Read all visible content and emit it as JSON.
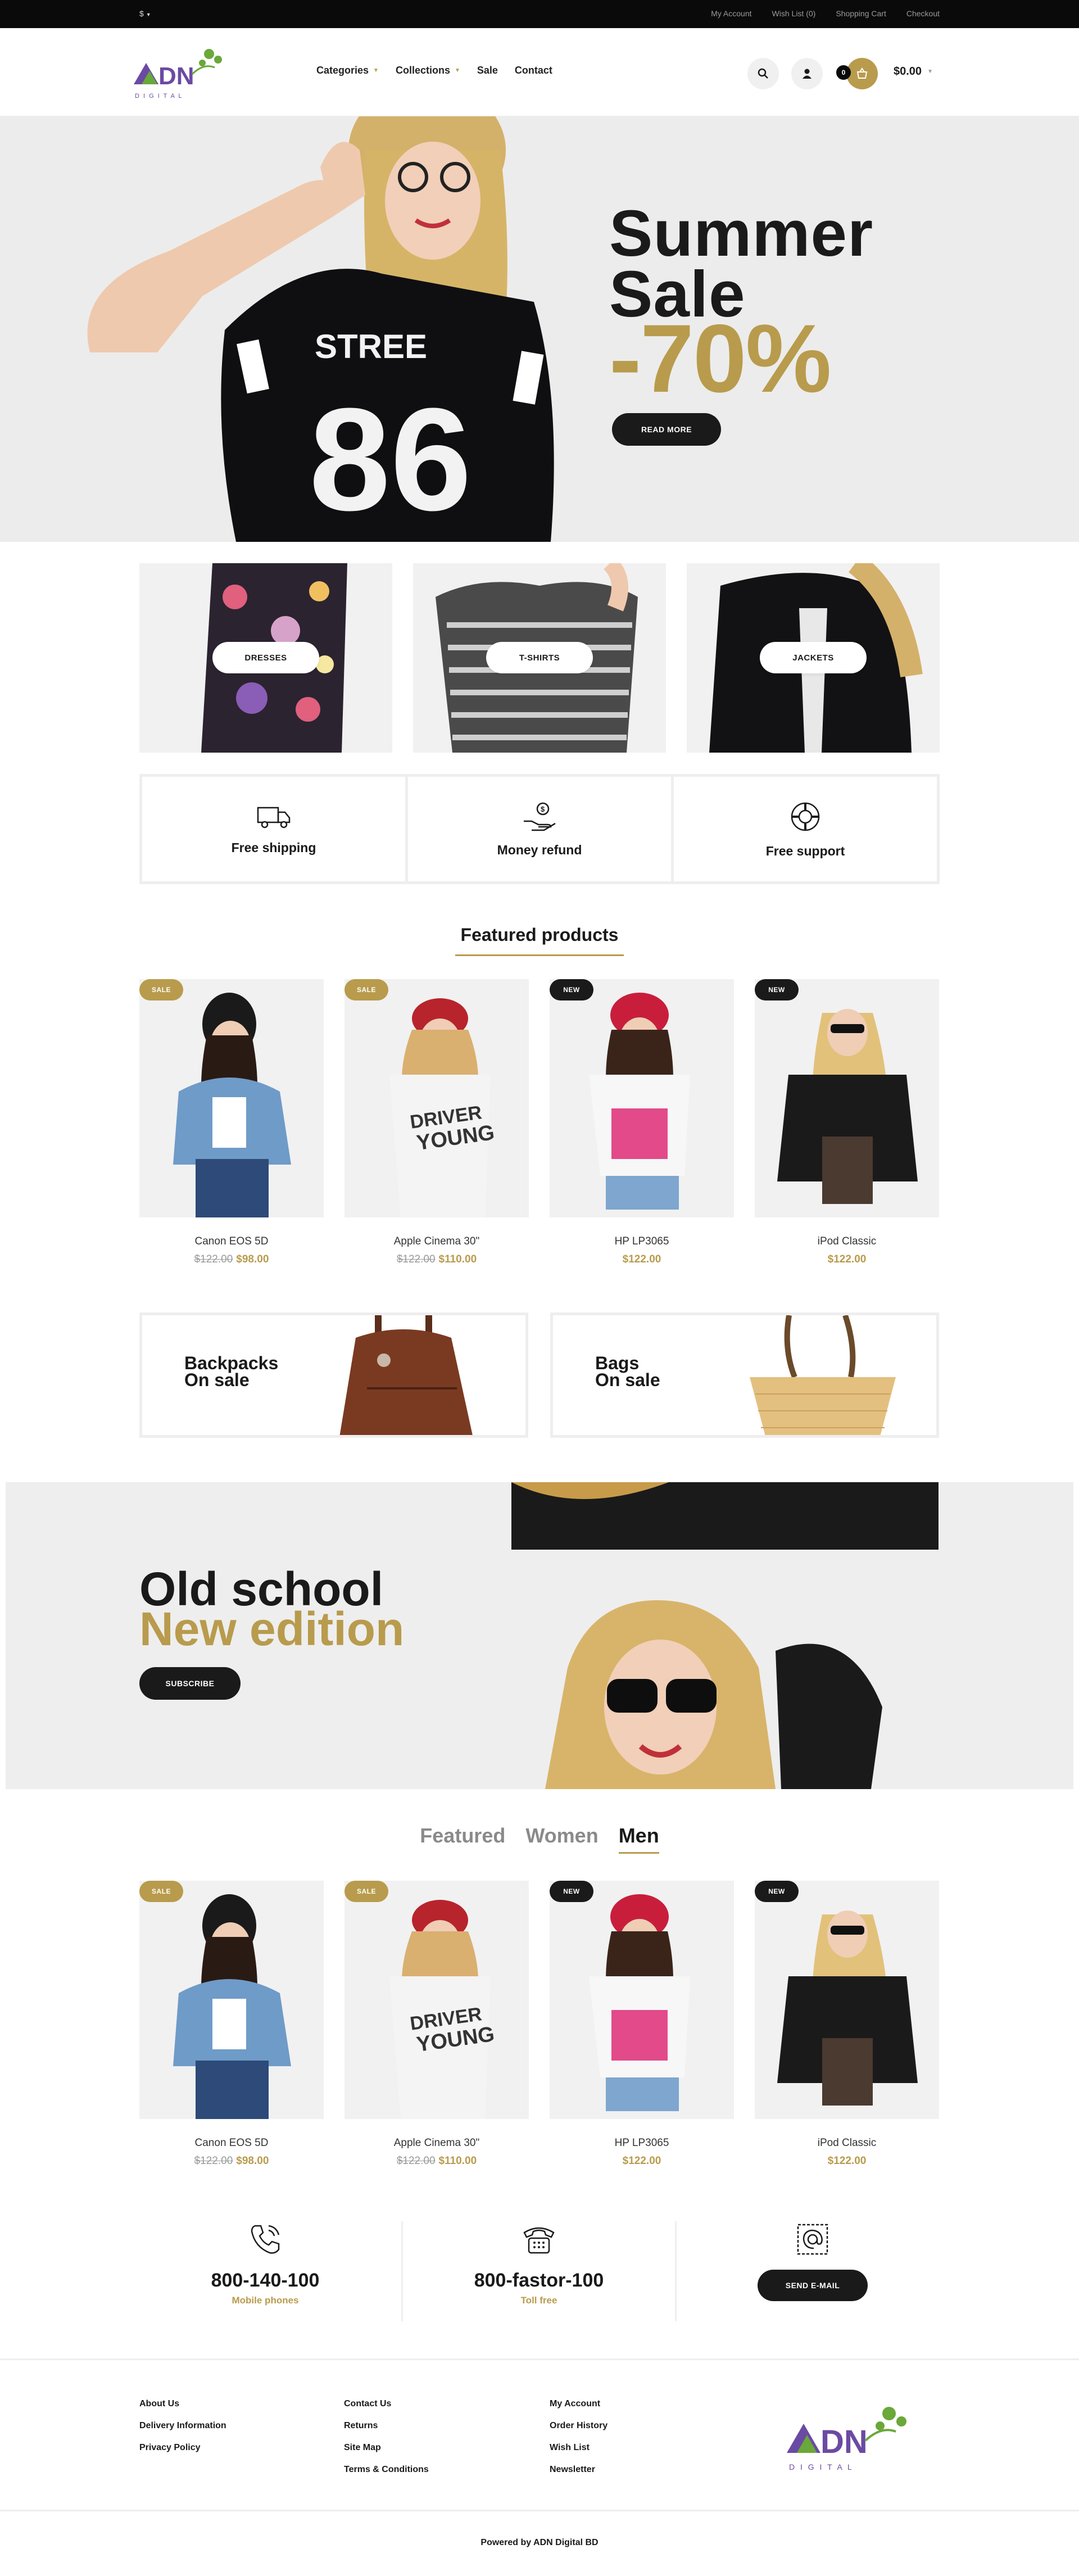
{
  "topbar": {
    "currency": "$",
    "links": [
      "My Account",
      "Wish List (0)",
      "Shopping Cart",
      "Checkout"
    ]
  },
  "header": {
    "logo_text": "ADN",
    "logo_sub": "D I G I T A L",
    "nav": [
      {
        "label": "Categories",
        "has_caret": true
      },
      {
        "label": "Collections",
        "has_caret": true
      },
      {
        "label": "Sale",
        "has_caret": false
      },
      {
        "label": "Contact",
        "has_caret": false
      }
    ],
    "cart_count": "0",
    "cart_total": "$0.00",
    "icons": [
      "search-icon",
      "user-icon",
      "cart-icon"
    ]
  },
  "hero": {
    "title_line1": "Summer",
    "title_line2": "Sale",
    "percent": "-70%",
    "button": "READ MORE"
  },
  "categories": [
    "DRESSES",
    "T-SHIRTS",
    "JACKETS"
  ],
  "features": [
    {
      "icon": "truck-icon",
      "label": "Free shipping"
    },
    {
      "icon": "money-refund-icon",
      "label": "Money refund"
    },
    {
      "icon": "lifebuoy-icon",
      "label": "Free support"
    }
  ],
  "featured": {
    "title": "Featured products",
    "products": [
      {
        "badge": "SALE",
        "name": "Canon EOS 5D",
        "old_price": "$122.00",
        "price": "$98.00"
      },
      {
        "badge": "SALE",
        "name": "Apple Cinema 30\"",
        "old_price": "$122.00",
        "price": "$110.00"
      },
      {
        "badge": "NEW",
        "name": "HP LP3065",
        "old_price": "",
        "price": "$122.00"
      },
      {
        "badge": "NEW",
        "name": "iPod Classic",
        "old_price": "",
        "price": "$122.00"
      }
    ]
  },
  "promos": [
    {
      "line1": "Backpacks",
      "line2": "On sale"
    },
    {
      "line1": "Bags",
      "line2": "On sale"
    }
  ],
  "banner": {
    "line1": "Old school",
    "line2": "New edition",
    "button": "SUBSCRIBE"
  },
  "tabs": {
    "items": [
      "Featured",
      "Women",
      "Men"
    ],
    "active": "Men",
    "products": [
      {
        "badge": "SALE",
        "name": "Canon EOS 5D",
        "old_price": "$122.00",
        "price": "$98.00"
      },
      {
        "badge": "SALE",
        "name": "Apple Cinema 30\"",
        "old_price": "$122.00",
        "price": "$110.00"
      },
      {
        "badge": "NEW",
        "name": "HP LP3065",
        "old_price": "",
        "price": "$122.00"
      },
      {
        "badge": "NEW",
        "name": "iPod Classic",
        "old_price": "",
        "price": "$122.00"
      }
    ]
  },
  "contact": {
    "mobile": {
      "number": "800-140-100",
      "label": "Mobile phones"
    },
    "tollfree": {
      "number": "800-fastor-100",
      "label": "Toll free"
    },
    "email_button": "SEND E-MAIL"
  },
  "footer": {
    "col1": [
      "About Us",
      "Delivery Information",
      "Privacy Policy"
    ],
    "col2": [
      "Contact Us",
      "Returns",
      "Site Map",
      "Terms & Conditions"
    ],
    "col3": [
      "My Account",
      "Order History",
      "Wish List",
      "Newsletter"
    ],
    "powered": "Powered by ADN Digital BD"
  },
  "colors": {
    "accent": "#b89b4c",
    "dark": "#1a1a1a",
    "logo_green": "#6aa83a",
    "logo_purple": "#6b4aa3"
  }
}
